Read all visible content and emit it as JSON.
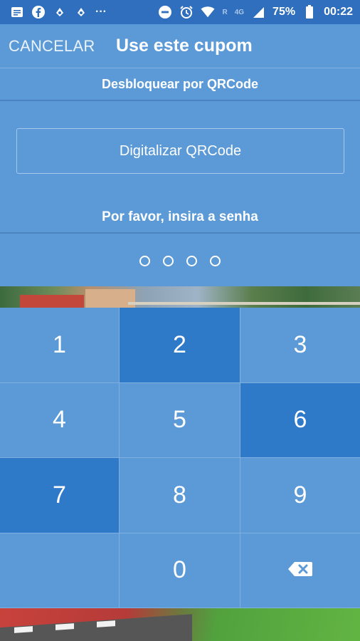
{
  "status_bar": {
    "battery_percent": "75%",
    "time": "00:22",
    "network_label": "4G",
    "signal_small": "R",
    "more": "···"
  },
  "header": {
    "cancel_label": "CANCELAR",
    "title": "Use este cupom"
  },
  "subheader": {
    "label": "Desbloquear por QRCode"
  },
  "scan_button": {
    "label": "Digitalizar QRCode"
  },
  "password": {
    "prompt": "Por favor, insira a senha",
    "digits_entered": 0,
    "length": 4
  },
  "keypad": {
    "keys": [
      {
        "label": "1",
        "pressed": false
      },
      {
        "label": "2",
        "pressed": true
      },
      {
        "label": "3",
        "pressed": false
      },
      {
        "label": "4",
        "pressed": false
      },
      {
        "label": "5",
        "pressed": false
      },
      {
        "label": "6",
        "pressed": true
      },
      {
        "label": "7",
        "pressed": true
      },
      {
        "label": "8",
        "pressed": false
      },
      {
        "label": "9",
        "pressed": false
      },
      {
        "label": "",
        "pressed": false
      },
      {
        "label": "0",
        "pressed": false
      },
      {
        "label": "",
        "pressed": false,
        "icon": "backspace-icon"
      }
    ]
  },
  "colors": {
    "primary": "#5b9ad6",
    "pressed": "#2f7ac8",
    "status_bar": "#2f6fbd",
    "text": "#ffffff"
  }
}
